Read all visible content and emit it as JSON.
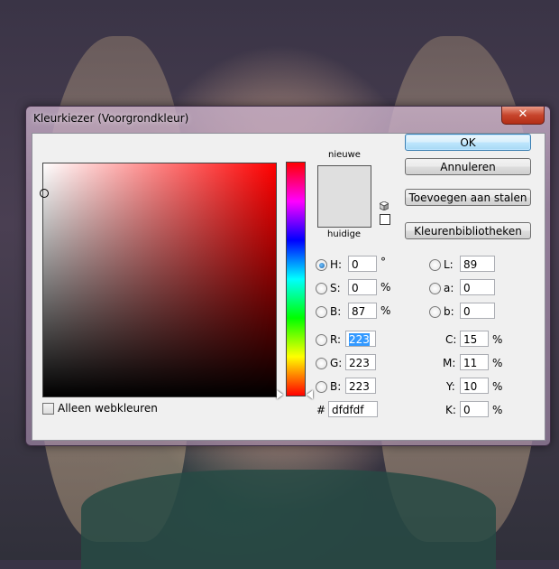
{
  "window": {
    "title": "Kleurkiezer (Voorgrondkleur)",
    "close_label": "✕"
  },
  "preview": {
    "new_label": "nieuwe",
    "current_label": "huidige",
    "new_color": "#dfdfdf",
    "current_color": "#dfdfdf"
  },
  "buttons": {
    "ok": "OK",
    "cancel": "Annuleren",
    "add_swatches": "Toevoegen aan stalen",
    "libraries": "Kleurenbibliotheken"
  },
  "web_only_label": "Alleen webkleuren",
  "hsb": {
    "h": {
      "label": "H:",
      "value": "0",
      "unit": "°"
    },
    "s": {
      "label": "S:",
      "value": "0",
      "unit": "%"
    },
    "b": {
      "label": "B:",
      "value": "87",
      "unit": "%"
    }
  },
  "rgb": {
    "r": {
      "label": "R:",
      "value": "223"
    },
    "g": {
      "label": "G:",
      "value": "223"
    },
    "b": {
      "label": "B:",
      "value": "223"
    }
  },
  "hex": {
    "label": "#",
    "value": "dfdfdf"
  },
  "lab": {
    "l": {
      "label": "L:",
      "value": "89"
    },
    "a": {
      "label": "a:",
      "value": "0"
    },
    "b": {
      "label": "b:",
      "value": "0"
    }
  },
  "cmyk": {
    "c": {
      "label": "C:",
      "value": "15",
      "unit": "%"
    },
    "m": {
      "label": "M:",
      "value": "11",
      "unit": "%"
    },
    "y": {
      "label": "Y:",
      "value": "10",
      "unit": "%"
    },
    "k": {
      "label": "K:",
      "value": "0",
      "unit": "%"
    }
  },
  "colors": {
    "hue_base": "#ff0000",
    "selection": "#3399ff"
  },
  "icons": {
    "close": "close-icon",
    "gamut": "cube-icon",
    "websafe": "websafe-square-icon"
  }
}
